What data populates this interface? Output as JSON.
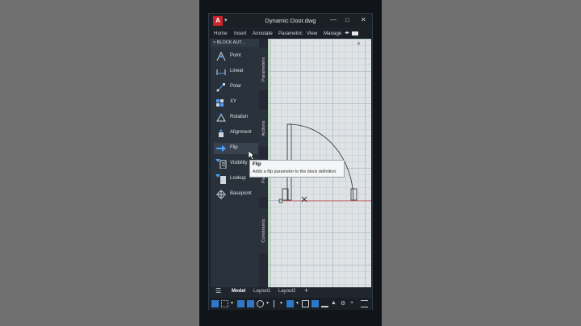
{
  "window": {
    "title": "Dynamic Door.dwg",
    "logo_letter": "A",
    "minimize_glyph": "—",
    "maximize_glyph": "□",
    "close_glyph": "✕"
  },
  "menu": {
    "items": [
      "Home",
      "Insert",
      "Annotate",
      "Parametric",
      "View",
      "Manage"
    ],
    "more_glyph": "◂▸"
  },
  "palette": {
    "header": "BLOCK AUT...",
    "tools": [
      {
        "label": "Point",
        "icon": "point-parameter-icon"
      },
      {
        "label": "Linear",
        "icon": "linear-parameter-icon"
      },
      {
        "label": "Polar",
        "icon": "polar-parameter-icon"
      },
      {
        "label": "XY",
        "icon": "xy-parameter-icon"
      },
      {
        "label": "Rotation",
        "icon": "rotation-parameter-icon"
      },
      {
        "label": "Alignment",
        "icon": "alignment-parameter-icon"
      },
      {
        "label": "Flip",
        "icon": "flip-parameter-icon"
      },
      {
        "label": "Visibility",
        "icon": "visibility-parameter-icon"
      },
      {
        "label": "Lookup",
        "icon": "lookup-parameter-icon"
      },
      {
        "label": "Basepoint",
        "icon": "basepoint-parameter-icon"
      }
    ],
    "active_tool": "Flip"
  },
  "side_tabs": [
    "Parameters",
    "Actions",
    "Pa...",
    "Constraints"
  ],
  "tooltip": {
    "title": "Flip",
    "description": "Adds a flip parameter to the block definition"
  },
  "layout_tabs": {
    "menu_glyph": "☰",
    "tabs": [
      "Model",
      "Layout1",
      "Layout2"
    ],
    "active": "Model",
    "add_glyph": "+"
  },
  "colors": {
    "accent_red": "#c8242b",
    "status_blue": "#2f77c9",
    "door_line": "#2b2b2b",
    "axis_red": "#d9534f"
  }
}
